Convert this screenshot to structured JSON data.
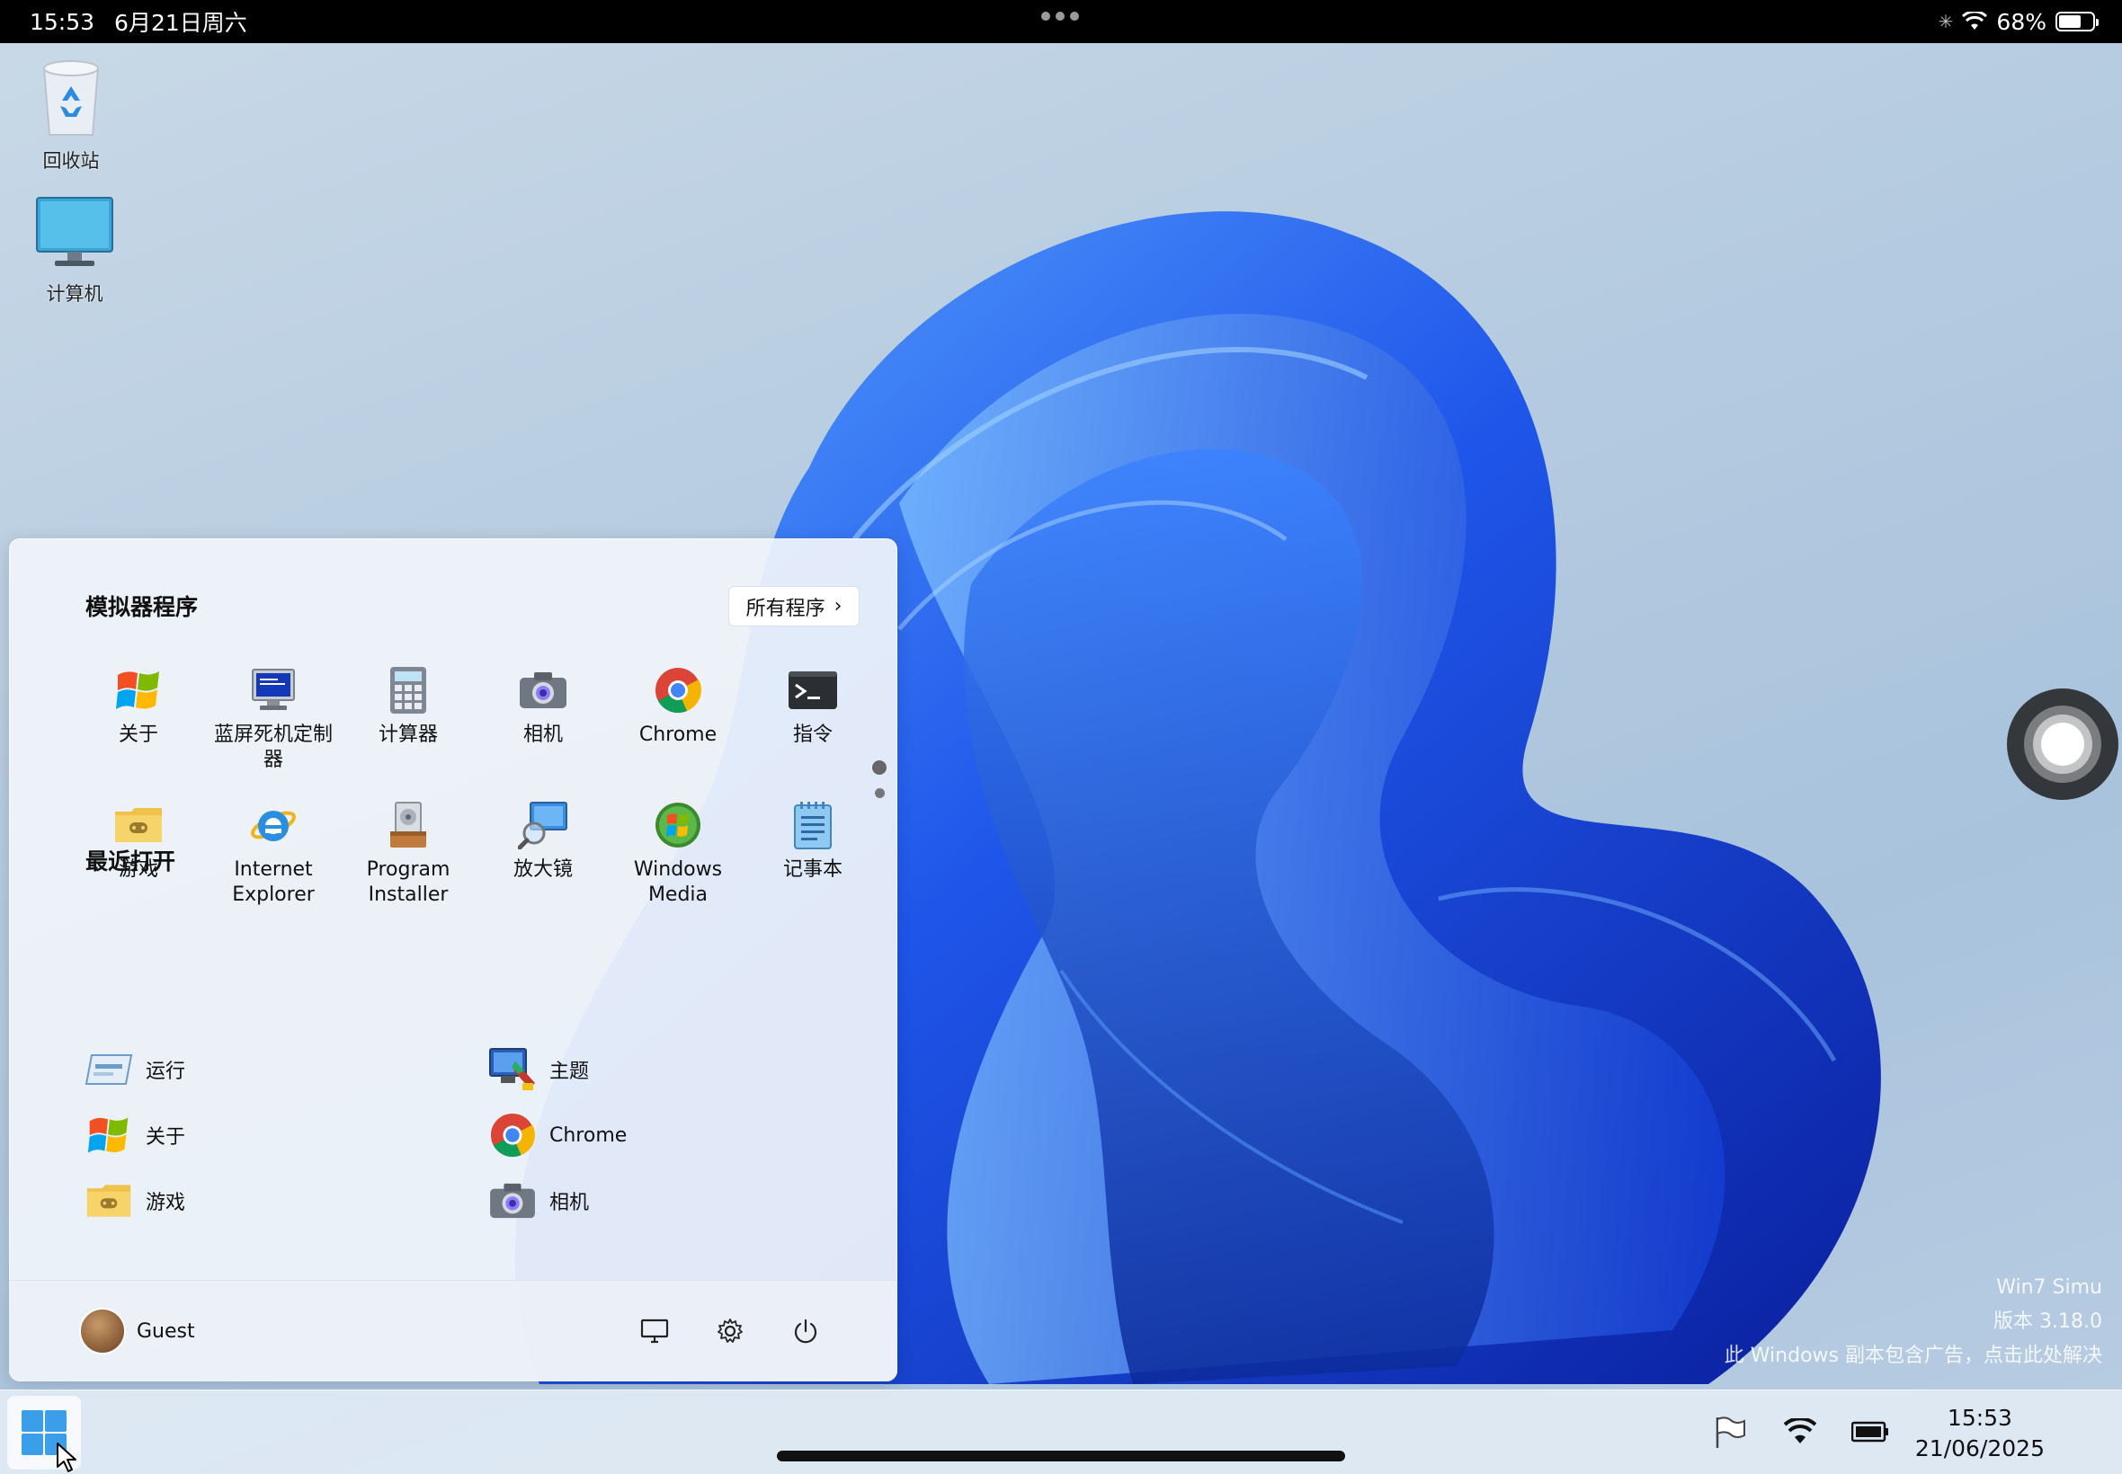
{
  "statusbar": {
    "time": "15:53",
    "date": "6月21日周六",
    "battery_percent_text": "68%",
    "battery_level": 0.68
  },
  "desktop": {
    "icons": [
      {
        "label": "回收站",
        "icon": "recycle-bin-icon"
      },
      {
        "label": "计算机",
        "icon": "computer-monitor-icon"
      }
    ]
  },
  "start_menu": {
    "pinned_title": "模拟器程序",
    "all_programs_label": "所有程序",
    "pinned": [
      {
        "label": "关于",
        "icon": "windows-logo-icon"
      },
      {
        "label": "蓝屏死机定制器",
        "icon": "bsod-monitor-icon"
      },
      {
        "label": "计算器",
        "icon": "calculator-icon"
      },
      {
        "label": "相机",
        "icon": "camera-icon"
      },
      {
        "label": "Chrome",
        "icon": "chrome-icon"
      },
      {
        "label": "指令",
        "icon": "terminal-icon"
      },
      {
        "label": "游戏",
        "icon": "games-folder-icon"
      },
      {
        "label": "Internet Explorer",
        "icon": "internet-explorer-icon"
      },
      {
        "label": "Program Installer",
        "icon": "installer-icon"
      },
      {
        "label": "放大镜",
        "icon": "magnifier-icon"
      },
      {
        "label": "Windows Media",
        "icon": "windows-media-icon"
      },
      {
        "label": "记事本",
        "icon": "notepad-icon"
      }
    ],
    "recent_title": "最近打开",
    "recent": [
      {
        "label": "运行",
        "icon": "run-icon"
      },
      {
        "label": "主题",
        "icon": "theme-icon"
      },
      {
        "label": "关于",
        "icon": "windows-logo-icon"
      },
      {
        "label": "Chrome",
        "icon": "chrome-icon"
      },
      {
        "label": "游戏",
        "icon": "games-folder-icon"
      },
      {
        "label": "相机",
        "icon": "camera-icon"
      }
    ],
    "user_name": "Guest"
  },
  "watermark": {
    "line1": "Win7 Simu",
    "line2": "版本 3.18.0",
    "line3": "此 Windows 副本包含广告，点击此处解决"
  },
  "taskbar": {
    "clock_time": "15:53",
    "clock_date": "21/06/2025"
  },
  "colors": {
    "wallpaper_blue": "#1f4fe0",
    "taskbar_bg": "#e1eaf4",
    "start_menu_bg": "#f0f4fa"
  }
}
